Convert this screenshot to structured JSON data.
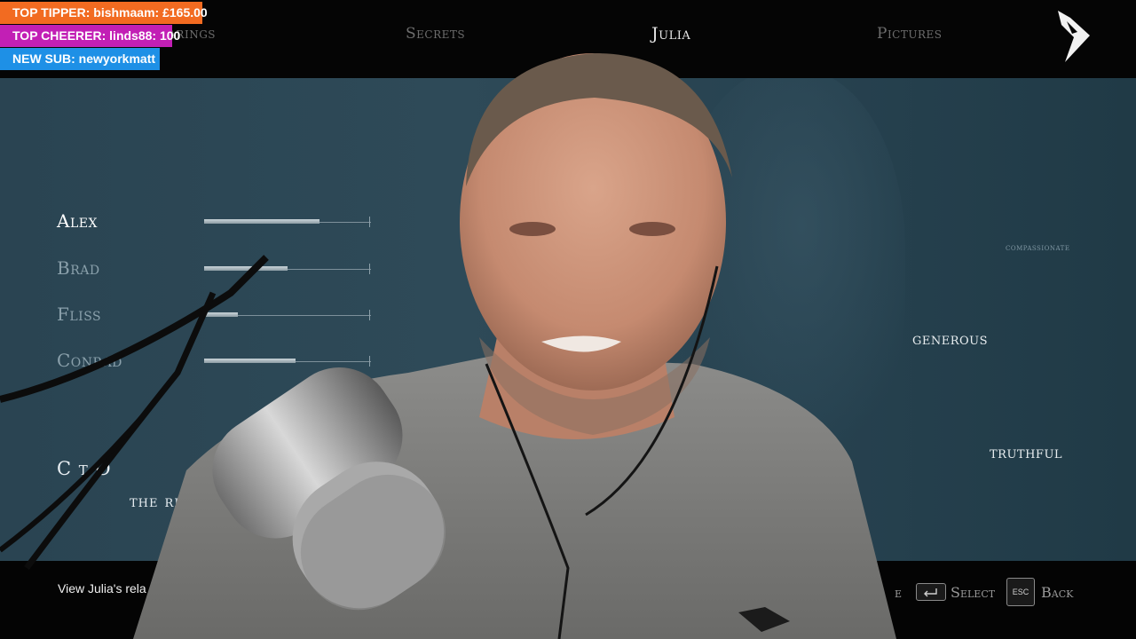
{
  "nav": {
    "tabs": [
      {
        "label": "Bearings",
        "visible_text": "earings"
      },
      {
        "label": "Secrets"
      },
      {
        "label": "Julia"
      },
      {
        "label": "Pictures"
      }
    ],
    "active_tab": "Julia"
  },
  "relationships": [
    {
      "name": "Alex",
      "value": 0.69,
      "active": true
    },
    {
      "name": "Brad",
      "value": 0.5,
      "active": false
    },
    {
      "name": "Fliss",
      "value": 0.2,
      "active": false
    },
    {
      "name": "Conrad",
      "value": 0.55,
      "active": false
    }
  ],
  "traits": {
    "compassionate": "compassionate",
    "generous": "generous",
    "truthful": "truthful"
  },
  "chapter_text": {
    "line1": "C     t O",
    "line2": "the rest"
  },
  "footer": {
    "hint": "View Julia's rela",
    "partial_label": "e",
    "select_label": "Select",
    "back_label": "Back",
    "esc_key": "ESC"
  },
  "stream_overlay": {
    "top_tipper": "TOP TIPPER: bishmaam: £165.00",
    "top_cheerer": "TOP CHEERER: linds88: 100",
    "new_sub": "NEW SUB: newyorkmatt",
    "colors": {
      "tipper": "#f26b21",
      "cheerer": "#c21fb5",
      "sub": "#1e90e6"
    }
  }
}
